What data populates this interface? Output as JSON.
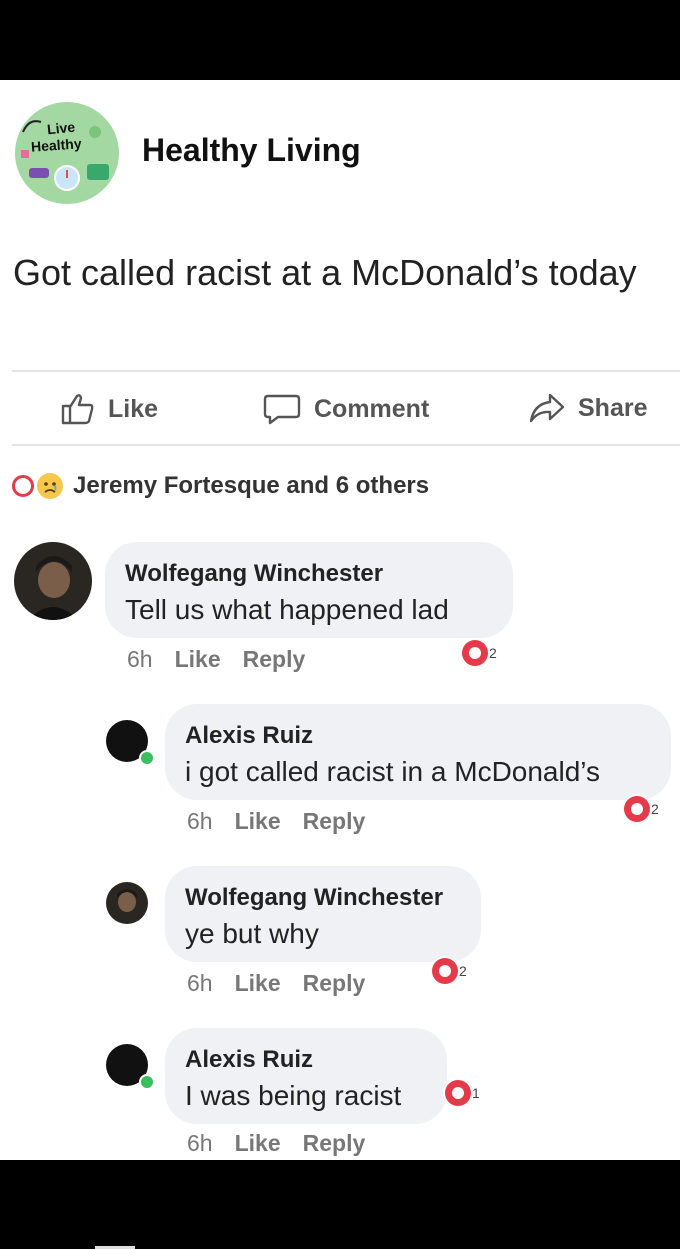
{
  "page": {
    "avatar_text_1": "Live",
    "avatar_text_2": "Healthy",
    "name": "Healthy Living"
  },
  "post": {
    "text": "Got called racist at a McDonald’s today"
  },
  "actions": {
    "like": "Like",
    "comment": "Comment",
    "share": "Share"
  },
  "reactions": {
    "summary": "Jeremy Fortesque and 6 others"
  },
  "comments": [
    {
      "name": "Wolfegang Winchester",
      "text": "Tell us what happened lad",
      "time": "6h",
      "like": "Like",
      "reply": "Reply",
      "reaction_count": "2"
    },
    {
      "name": "Alexis Ruiz",
      "text": "i got called racist in a McDonald’s",
      "time": "6h",
      "like": "Like",
      "reply": "Reply",
      "reaction_count": "2"
    },
    {
      "name": "Wolfegang Winchester",
      "text": "ye but why",
      "time": "6h",
      "like": "Like",
      "reply": "Reply",
      "reaction_count": "2"
    },
    {
      "name": "Alexis Ruiz",
      "text": "I was being racist",
      "time": "6h",
      "like": "Like",
      "reply": "Reply",
      "reaction_count": "1"
    }
  ],
  "colors": {
    "reaction_red": "#e53a4a",
    "bubble_bg": "#f0f1f4",
    "avatar_green": "#a4d8a3"
  },
  "icons": [
    "thumbs-up-icon",
    "comment-icon",
    "share-icon",
    "heart-reaction-icon",
    "sad-reaction-icon"
  ]
}
